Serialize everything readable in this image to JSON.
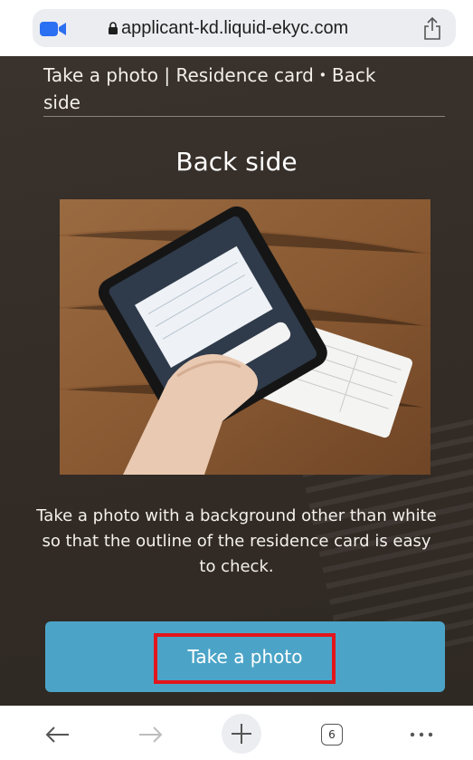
{
  "browser": {
    "url": "applicant-kd.liquid-ekyc.com",
    "tab_count": "6"
  },
  "page": {
    "header_title": "Take a photo | Residence card・Back side",
    "heading": "Back side",
    "instruction": "Take a photo with a background other than white so that the outline of the residence card is easy to check.",
    "button_label": "Take a photo"
  },
  "icons": {
    "video": "video-camera-icon",
    "lock": "lock-icon",
    "share": "share-icon",
    "back": "back-arrow-icon",
    "forward": "forward-arrow-icon",
    "new_tab": "plus-icon",
    "tabs": "tabs-icon",
    "more": "more-icon"
  },
  "colors": {
    "button": "#4ba4c7",
    "highlight": "#e2161c",
    "background": "#3b332d",
    "video_icon": "#2b6ff2"
  }
}
